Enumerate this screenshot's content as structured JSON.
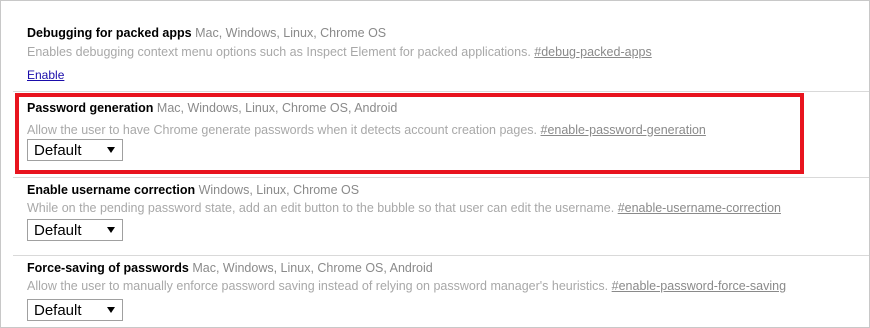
{
  "flags": [
    {
      "name": "Debugging for packed apps",
      "platforms": "Mac, Windows, Linux, Chrome OS",
      "description": "Enables debugging context menu options such as Inspect Element for packed applications.",
      "anchor": "#debug-packed-apps",
      "action": "Enable"
    },
    {
      "name": "Password generation",
      "platforms": "Mac, Windows, Linux, Chrome OS, Android",
      "description": "Allow the user to have Chrome generate passwords when it detects account creation pages.",
      "anchor": "#enable-password-generation",
      "select_value": "Default"
    },
    {
      "name": "Enable username correction",
      "platforms": "Windows, Linux, Chrome OS",
      "description": "While on the pending password state, add an edit button to the bubble so that user can edit the username.",
      "anchor": "#enable-username-correction",
      "select_value": "Default"
    },
    {
      "name": "Force-saving of passwords",
      "platforms": "Mac, Windows, Linux, Chrome OS, Android",
      "description": "Allow the user to manually enforce password saving instead of relying on password manager's heuristics.",
      "anchor": "#enable-password-force-saving",
      "select_value": "Default"
    }
  ],
  "highlight": {
    "color": "#e8141e"
  },
  "icons": {
    "dropdown": "caret-down-icon"
  }
}
